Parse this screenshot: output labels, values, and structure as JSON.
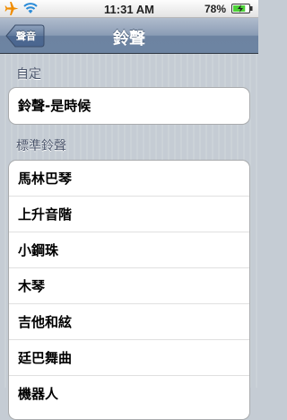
{
  "status_bar": {
    "time": "11:31 AM",
    "battery_percent": "78%",
    "icons": [
      "airplane-icon",
      "wifi-icon",
      "battery-charging-icon"
    ],
    "battery_level": 0.78
  },
  "nav": {
    "back_label": "聲音",
    "title": "鈴聲"
  },
  "sections": [
    {
      "header": "自定",
      "items": [
        "鈴聲-是時候"
      ]
    },
    {
      "header": "標準鈴聲",
      "items": [
        "馬林巴琴",
        "上升音階",
        "小鋼珠",
        "木琴",
        "吉他和絃",
        "廷巴舞曲",
        "機器人"
      ]
    }
  ],
  "colors": {
    "nav_bar": "#6d84a2",
    "background": "#c5ccd4",
    "section_header": "#4c566c",
    "battery_fill": "#4cd137"
  }
}
